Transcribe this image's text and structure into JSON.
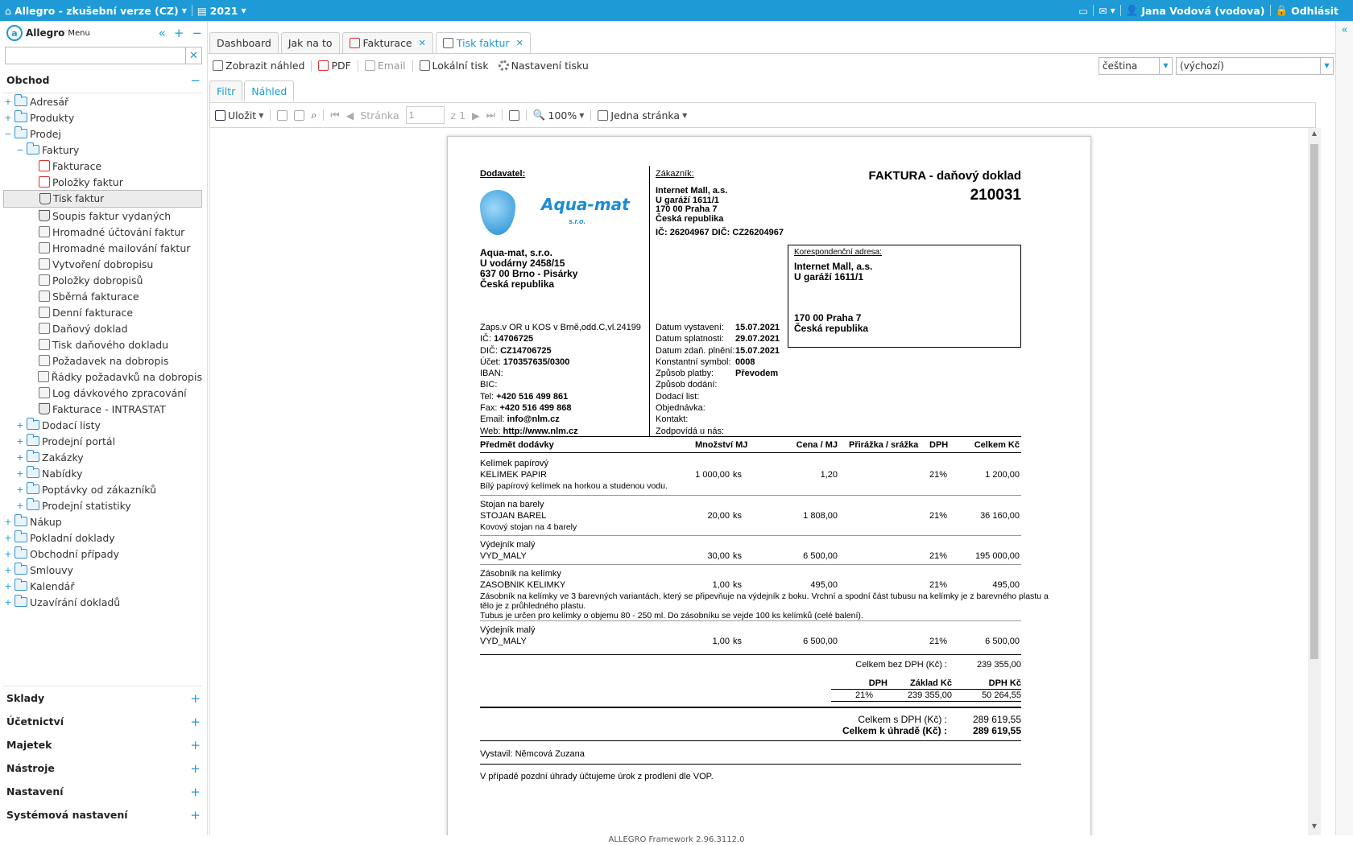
{
  "topbar": {
    "app_title": "Allegro - zkušební verze (CZ)",
    "year": "2021",
    "user": "Jana Vodová (vodova)",
    "logout": "Odhlásit"
  },
  "sidebar": {
    "brand": "Allegro",
    "menu": "Menu",
    "search_value": "",
    "section_title": "Obchod",
    "tree": [
      {
        "label": "Adresář",
        "level": 0,
        "type": "folder",
        "exp": "+"
      },
      {
        "label": "Produkty",
        "level": 0,
        "type": "folder",
        "exp": "+"
      },
      {
        "label": "Prodej",
        "level": 0,
        "type": "folder",
        "exp": "−"
      },
      {
        "label": "Faktury",
        "level": 1,
        "type": "folder",
        "exp": "−"
      },
      {
        "label": "Fakturace",
        "level": 2,
        "type": "pdf"
      },
      {
        "label": "Položky faktur",
        "level": 2,
        "type": "pdf"
      },
      {
        "label": "Tisk faktur",
        "level": 2,
        "type": "prn",
        "selected": true
      },
      {
        "label": "Soupis faktur vydaných",
        "level": 2,
        "type": "prn"
      },
      {
        "label": "Hromadné účtování faktur",
        "level": 2,
        "type": "doc"
      },
      {
        "label": "Hromadné mailování faktur",
        "level": 2,
        "type": "doc"
      },
      {
        "label": "Vytvoření dobropisu",
        "level": 2,
        "type": "doc"
      },
      {
        "label": "Položky dobropisů",
        "level": 2,
        "type": "doc"
      },
      {
        "label": "Sběrná fakturace",
        "level": 2,
        "type": "doc"
      },
      {
        "label": "Denní fakturace",
        "level": 2,
        "type": "doc"
      },
      {
        "label": "Daňový doklad",
        "level": 2,
        "type": "doc"
      },
      {
        "label": "Tisk daňového dokladu",
        "level": 2,
        "type": "doc"
      },
      {
        "label": "Požadavek na dobropis",
        "level": 2,
        "type": "doc"
      },
      {
        "label": "Řádky požadavků na dobropis",
        "level": 2,
        "type": "doc"
      },
      {
        "label": "Log dávkového zpracování",
        "level": 2,
        "type": "doc"
      },
      {
        "label": "Fakturace - INTRASTAT",
        "level": 2,
        "type": "prn"
      },
      {
        "label": "Dodací listy",
        "level": 1,
        "type": "folder",
        "exp": "+"
      },
      {
        "label": "Prodejní portál",
        "level": 1,
        "type": "folder",
        "exp": "+"
      },
      {
        "label": "Zakázky",
        "level": 1,
        "type": "folder",
        "exp": "+"
      },
      {
        "label": "Nabídky",
        "level": 1,
        "type": "folder",
        "exp": "+"
      },
      {
        "label": "Poptávky od zákazníků",
        "level": 1,
        "type": "folder",
        "exp": "+"
      },
      {
        "label": "Prodejní statistiky",
        "level": 1,
        "type": "folder",
        "exp": "+"
      },
      {
        "label": "Nákup",
        "level": 0,
        "type": "folder",
        "exp": "+"
      },
      {
        "label": "Pokladní doklady",
        "level": 0,
        "type": "folder",
        "exp": "+"
      },
      {
        "label": "Obchodní případy",
        "level": 0,
        "type": "folder",
        "exp": "+"
      },
      {
        "label": "Smlouvy",
        "level": 0,
        "type": "folder",
        "exp": "+"
      },
      {
        "label": "Kalendář",
        "level": 0,
        "type": "folder",
        "exp": "+"
      },
      {
        "label": "Uzavírání dokladů",
        "level": 0,
        "type": "folder",
        "exp": "+"
      }
    ],
    "sections": [
      "Sklady",
      "Účetnictví",
      "Majetek",
      "Nástroje",
      "Nastavení",
      "Systémová nastavení"
    ]
  },
  "tabs": [
    {
      "label": "Dashboard",
      "closable": false,
      "active": false
    },
    {
      "label": "Jak na to",
      "closable": false,
      "active": false
    },
    {
      "label": "Fakturace",
      "closable": true,
      "active": false
    },
    {
      "label": "Tisk faktur",
      "closable": true,
      "active": true
    }
  ],
  "toolbar": {
    "preview": "Zobrazit náhled",
    "pdf": "PDF",
    "email": "Email",
    "local_print": "Lokální tisk",
    "print_settings": "Nastavení tisku",
    "language": "čeština",
    "template": "(výchozí)"
  },
  "subtabs": [
    "Filtr",
    "Náhled"
  ],
  "viewer": {
    "save": "Uložit",
    "page_label": "Stránka",
    "page_value": "1",
    "page_of": "z 1",
    "zoom": "100%",
    "layout": "Jedna stránka"
  },
  "invoice": {
    "supplier_label": "Dodavatel:",
    "customer_label": "Zákazník:",
    "title": "FAKTURA - daňový doklad",
    "number": "210031",
    "logo_text": "Aqua-mat",
    "logo_sub": "s.r.o.",
    "customer": [
      "Internet Mall, a.s.",
      "U garáží 1611/1",
      "170 00 Praha 7",
      "Česká republika"
    ],
    "customer_ids": "IČ: 26204967 DIČ: CZ26204967",
    "corr_label": "Korespondenční adresa:",
    "corr_top": [
      "Internet Mall, a.s.",
      "U garáží 1611/1"
    ],
    "corr_bottom": [
      "170 00 Praha 7",
      "Česká republika"
    ],
    "supplier": [
      "Aqua-mat, s.r.o.",
      "U vodárny 2458/15",
      "637 00 Brno - Pisárky",
      "Česká republika"
    ],
    "supplier_info": [
      {
        "label": "Zaps.v OR u KOS v Brně,odd.C,vl.24199",
        "value": ""
      },
      {
        "label": "IČ: ",
        "value": "14706725"
      },
      {
        "label": "DIČ: ",
        "value": "CZ14706725"
      },
      {
        "label": "Účet: ",
        "value": "170357635/0300"
      },
      {
        "label": "IBAN:",
        "value": ""
      },
      {
        "label": "BIC:",
        "value": ""
      },
      {
        "label": "Tel: ",
        "value": "+420 516 499 861"
      },
      {
        "label": "Fax: ",
        "value": "+420 516 499 868"
      },
      {
        "label": "Email: ",
        "value": "info@nlm.cz"
      },
      {
        "label": "Web: ",
        "value": "http://www.nlm.cz"
      }
    ],
    "details": [
      {
        "label": "Datum vystavení:",
        "value": "15.07.2021"
      },
      {
        "label": "Datum splatnosti:",
        "value": "29.07.2021"
      },
      {
        "label": "Datum zdaň. plnění:",
        "value": "15.07.2021"
      },
      {
        "label": "Konstantní symbol:",
        "value": "0008"
      },
      {
        "label": "Způsob platby:",
        "value": "Převodem"
      },
      {
        "label": "Způsob dodání:",
        "value": ""
      },
      {
        "label": "Dodací list:",
        "value": ""
      },
      {
        "label": "Objednávka:",
        "value": ""
      },
      {
        "label": "Kontakt:",
        "value": ""
      },
      {
        "label": "Zodpovídá u nás:",
        "value": ""
      }
    ],
    "columns": {
      "subject": "Předmět dodávky",
      "qty": "Množství MJ",
      "price": "Cena / MJ",
      "surcharge": "Přirážka / srážka",
      "vat": "DPH",
      "total": "Celkem Kč"
    },
    "items": [
      {
        "name": "Kelímek papírový",
        "code": "KELIMEK PAPIR",
        "qty": "1 000,00",
        "unit": "ks",
        "price": "1,20",
        "vat": "21%",
        "total": "1 200,00",
        "desc": [
          "Bílý papírový kelímek na horkou a studenou vodu."
        ]
      },
      {
        "name": "Stojan na barely",
        "code": "STOJAN BAREL",
        "qty": "20,00",
        "unit": "ks",
        "price": "1 808,00",
        "vat": "21%",
        "total": "36 160,00",
        "desc": [
          "Kovový stojan na 4 barely"
        ]
      },
      {
        "name": "Výdejník malý",
        "code": "VYD_MALY",
        "qty": "30,00",
        "unit": "ks",
        "price": "6 500,00",
        "vat": "21%",
        "total": "195 000,00",
        "desc": []
      },
      {
        "name": "Zásobník na kelímky",
        "code": "ZASOBNIK KELIMKY",
        "qty": "1,00",
        "unit": "ks",
        "price": "495,00",
        "vat": "21%",
        "total": "495,00",
        "desc": [
          "Zásobník na kelímky ve 3 barevných variantách, který se připevňuje na výdejník z boku. Vrchní a spodní část tubusu na kelímky je z barevného plastu a",
          "tělo je z průhledného plastu.",
          "Tubus je určen pro kelímky o objemu 80 - 250 ml. Do zásobníku se vejde 100 ks kelímků (celé balení)."
        ]
      },
      {
        "name": "Výdejník malý",
        "code": "VYD_MALY",
        "qty": "1,00",
        "unit": "ks",
        "price": "6 500,00",
        "vat": "21%",
        "total": "6 500,00",
        "desc": []
      }
    ],
    "sum_no_vat_label": "Celkem bez DPH (Kč) :",
    "sum_no_vat": "239 355,00",
    "vat_table": {
      "h_rate": "DPH",
      "h_base": "Základ Kč",
      "h_vat": "DPH Kč",
      "rate": "21%",
      "base": "239 355,00",
      "vat": "50 264,55"
    },
    "sum_vat_label": "Celkem s DPH (Kč) :",
    "sum_vat": "289 619,55",
    "to_pay_label": "Celkem k úhradě (Kč) :",
    "to_pay": "289 619,55",
    "issued_by": "Vystavil: Němcová Zuzana",
    "note": "V případě pozdní úhrady účtujeme úrok z prodlení dle VOP."
  },
  "footer": "ALLEGRO Framework 2.96.3112.0"
}
